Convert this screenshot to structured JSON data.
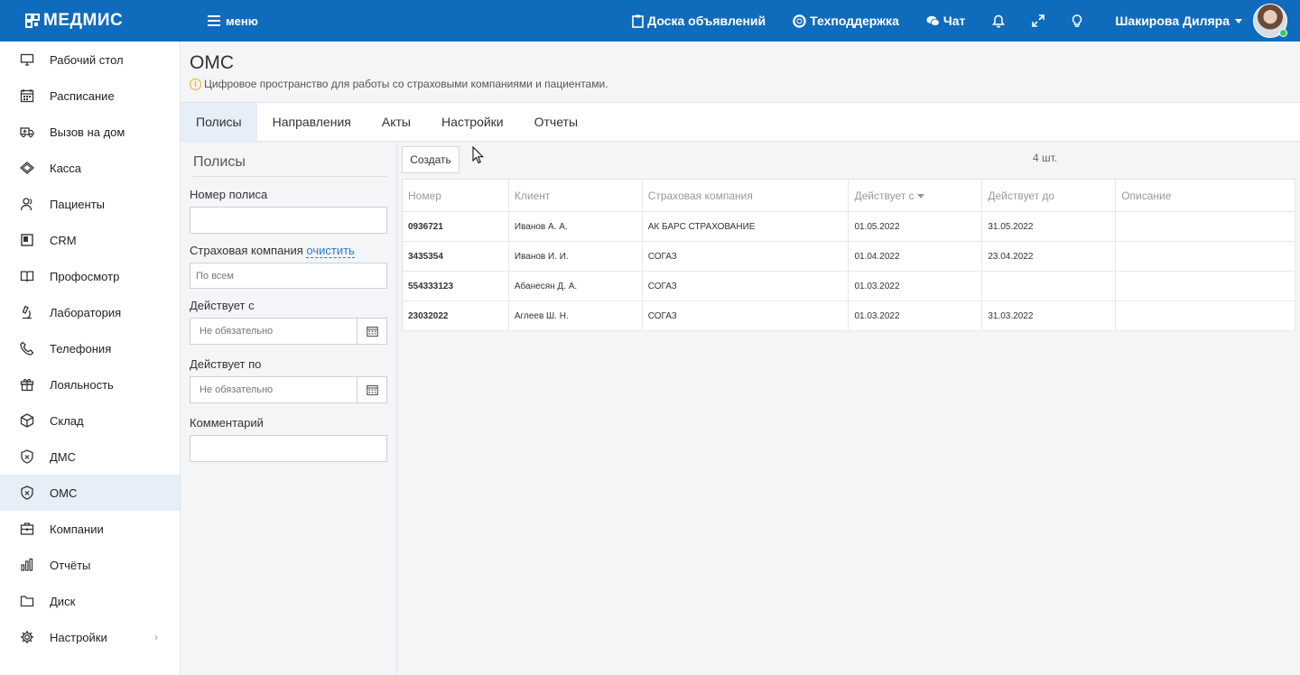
{
  "header": {
    "logo_text": "МЕДМИС",
    "menu_label": "меню",
    "links": {
      "board": "Доска объявлений",
      "support": "Техподдержка",
      "chat": "Чат"
    },
    "user_name": "Шакирова Диляра"
  },
  "sidebar": {
    "items": [
      {
        "label": "Рабочий стол",
        "icon": "monitor-icon"
      },
      {
        "label": "Расписание",
        "icon": "calendar-icon"
      },
      {
        "label": "Вызов на дом",
        "icon": "ambulance-icon"
      },
      {
        "label": "Касса",
        "icon": "money-icon"
      },
      {
        "label": "Пациенты",
        "icon": "users-icon"
      },
      {
        "label": "CRM",
        "icon": "crm-icon"
      },
      {
        "label": "Профосмотр",
        "icon": "book-icon"
      },
      {
        "label": "Лаборатория",
        "icon": "microscope-icon"
      },
      {
        "label": "Телефония",
        "icon": "phone-icon"
      },
      {
        "label": "Лояльность",
        "icon": "gift-icon"
      },
      {
        "label": "Склад",
        "icon": "box-icon"
      },
      {
        "label": "ДМС",
        "icon": "shield-icon"
      },
      {
        "label": "ОМС",
        "icon": "shield-icon"
      },
      {
        "label": "Компании",
        "icon": "briefcase-icon"
      },
      {
        "label": "Отчёты",
        "icon": "bar-chart-icon"
      },
      {
        "label": "Диск",
        "icon": "folder-icon"
      },
      {
        "label": "Настройки",
        "icon": "gear-icon"
      }
    ],
    "active_index": 12
  },
  "page": {
    "title": "ОМС",
    "subtitle": "Цифровое пространство для работы со страховыми компаниями и пациентами."
  },
  "tabs": [
    "Полисы",
    "Направления",
    "Акты",
    "Настройки",
    "Отчеты"
  ],
  "filter": {
    "title": "Полисы",
    "policy_number_label": "Номер полиса",
    "policy_number_value": "",
    "insurance_label": "Страховая компания",
    "insurance_clear": "очистить",
    "insurance_value": "По всем",
    "valid_from_label": "Действует с",
    "valid_from_placeholder": "Не обязательно",
    "valid_to_label": "Действует по",
    "valid_to_placeholder": "Не обязательно",
    "comment_label": "Комментарий",
    "comment_value": ""
  },
  "list": {
    "create_label": "Создать",
    "count": "4 шт.",
    "columns": [
      "Номер",
      "Клиент",
      "Страховая компания",
      "Действует с",
      "Действует до",
      "Описание"
    ],
    "rows": [
      [
        "0936721",
        "Иванов А. А.",
        "АК БАРС СТРАХОВАНИЕ",
        "01.05.2022",
        "31.05.2022",
        ""
      ],
      [
        "3435354",
        "Иванов И. И.",
        "СОГАЗ",
        "01.04.2022",
        "23.04.2022",
        ""
      ],
      [
        "554333123",
        "Абанесян Д. А.",
        "СОГАЗ",
        "01.03.2022",
        "",
        ""
      ],
      [
        "23032022",
        "Аглеев Ш. Н.",
        "СОГАЗ",
        "01.03.2022",
        "31.03.2022",
        ""
      ]
    ]
  }
}
